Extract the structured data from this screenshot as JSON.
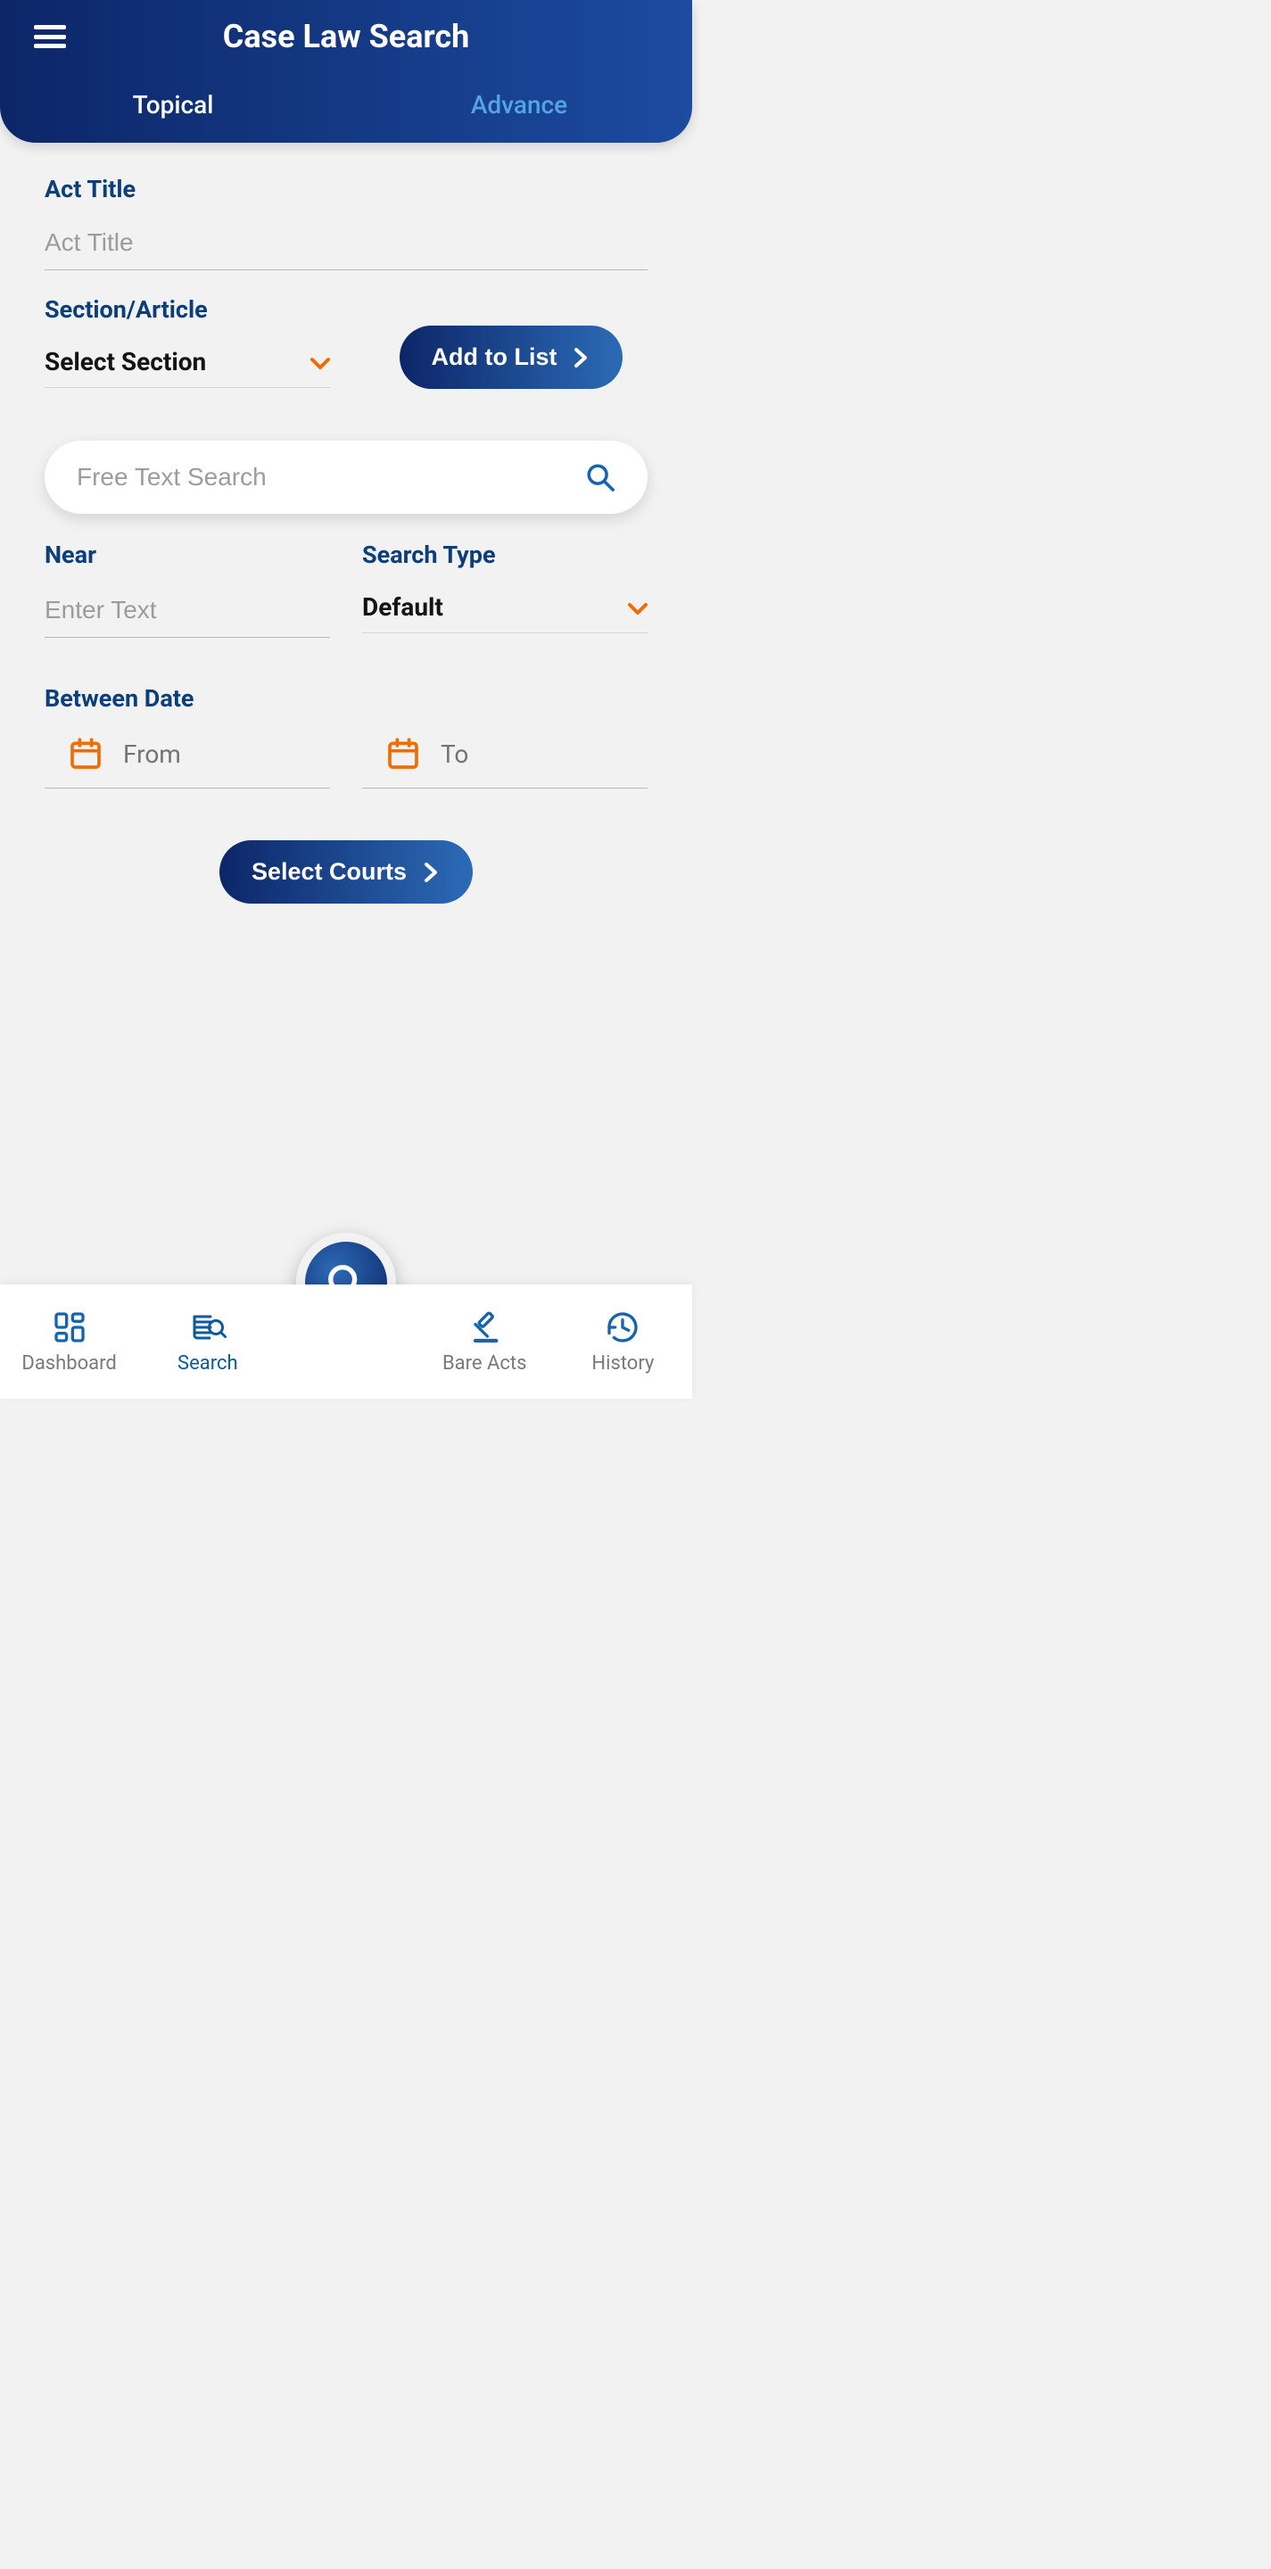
{
  "header": {
    "title": "Case Law Search",
    "tabs": {
      "topical": "Topical",
      "advance": "Advance"
    }
  },
  "form": {
    "act_title_label": "Act Title",
    "act_title_placeholder": "Act Title",
    "section_label": "Section/Article",
    "section_value": "Select Section",
    "add_to_list": "Add to List",
    "free_text_placeholder": "Free Text Search",
    "near_label": "Near",
    "near_placeholder": "Enter Text",
    "search_type_label": "Search Type",
    "search_type_value": "Default",
    "between_date_label": "Between Date",
    "from_label": "From",
    "to_label": "To",
    "select_courts": "Select Courts"
  },
  "nav": {
    "dashboard": "Dashboard",
    "search": "Search",
    "bare_acts": "Bare Acts",
    "history": "History"
  },
  "colors": {
    "brand_dark": "#0c2668",
    "brand_light": "#2c6ab6",
    "accent_orange": "#ef6c00",
    "label_blue": "#0b3f7c"
  }
}
